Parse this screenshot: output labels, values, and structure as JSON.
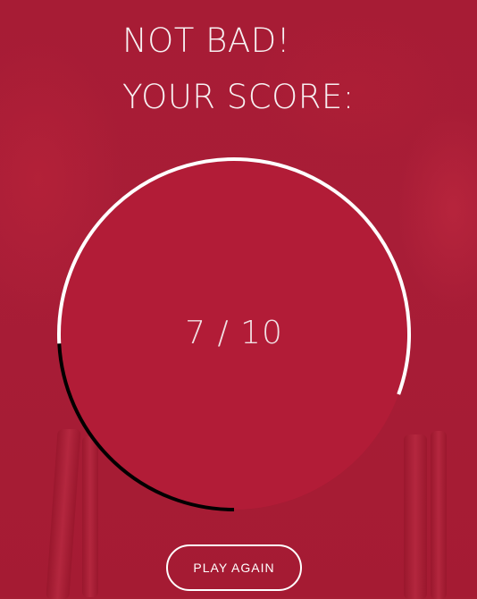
{
  "result": {
    "headline": "NOT BAD!",
    "score_label": "YOUR SCORE:",
    "score_text": "7 / 10",
    "score": 7,
    "max_score": 10
  },
  "actions": {
    "play_again_label": "PLAY AGAIN"
  },
  "colors": {
    "background": "#a51d33",
    "circle_fill": "#b21c37",
    "ring_score": "#ffffff",
    "ring_missed": "#000000",
    "text": "#f7f0f2"
  }
}
